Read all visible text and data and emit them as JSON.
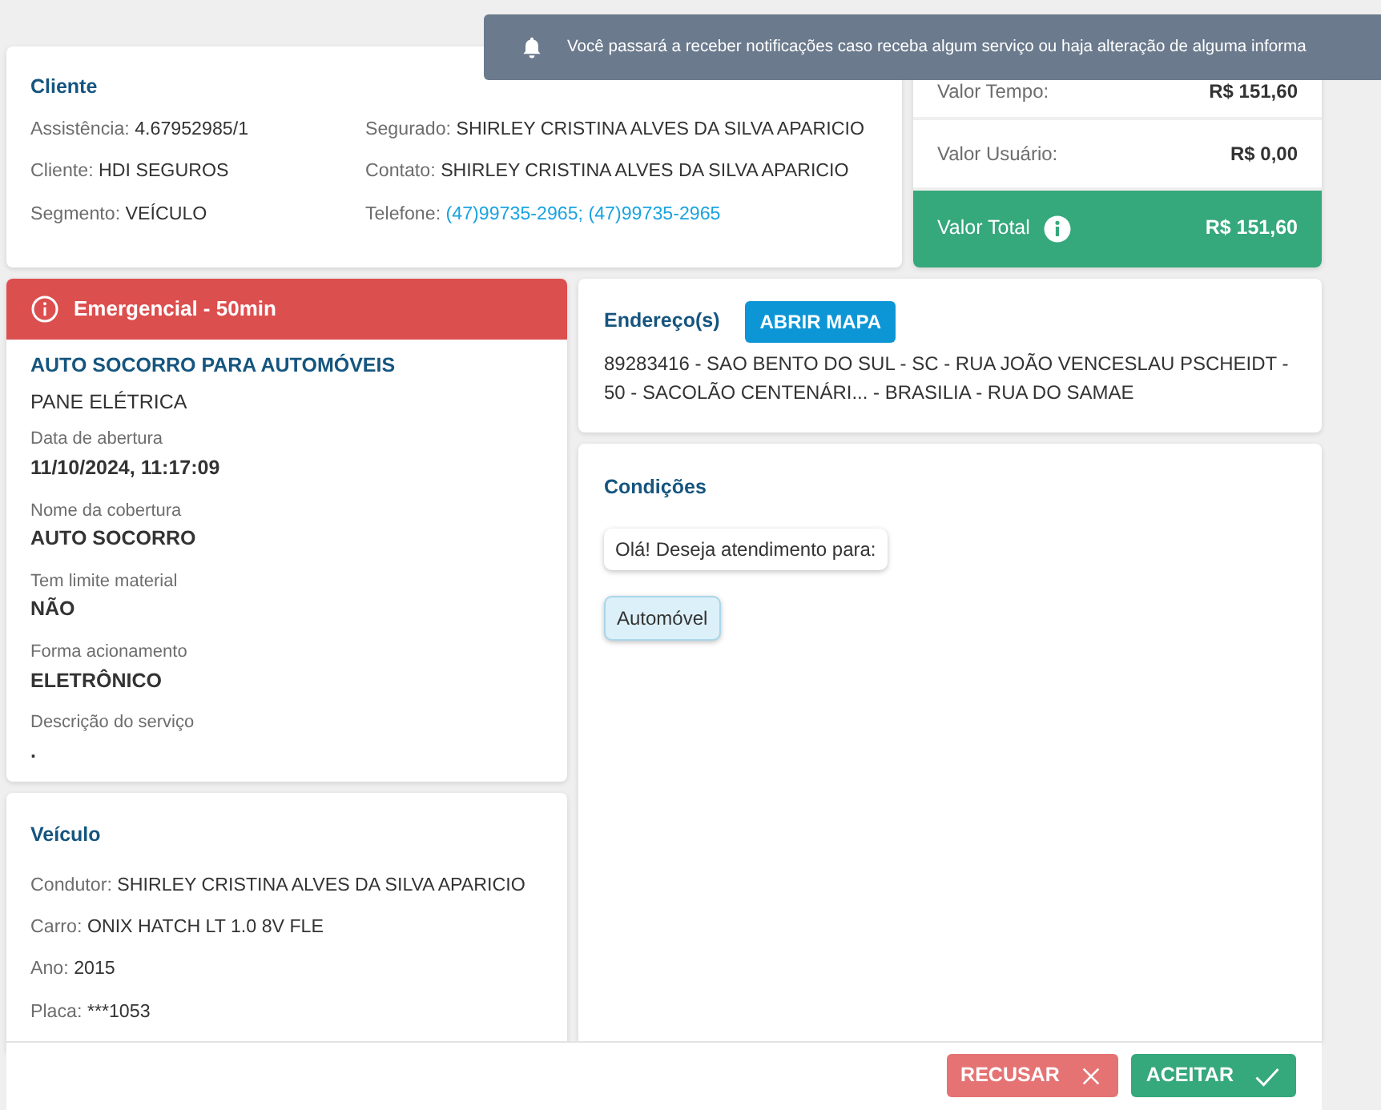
{
  "notification": {
    "text": "Você passará a receber notificações caso receba algum serviço ou haja alteração de alguma informa"
  },
  "client": {
    "title": "Cliente",
    "columns": [
      [
        {
          "label": "Assistência:",
          "value": "4.67952985/1",
          "kind": "text"
        },
        {
          "label": "Cliente:",
          "value": "HDI SEGUROS",
          "kind": "text"
        },
        {
          "label": "Segmento:",
          "value": "VEÍCULO",
          "kind": "text"
        }
      ],
      [
        {
          "label": "Segurado:",
          "value": "SHIRLEY CRISTINA ALVES DA SILVA APARICIO",
          "kind": "text"
        },
        {
          "label": "Contato:",
          "value": "SHIRLEY CRISTINA ALVES DA SILVA APARICIO",
          "kind": "text"
        },
        {
          "label": "Telefone:",
          "value": "(47)99735-2965; (47)99735-2965",
          "kind": "link"
        }
      ]
    ]
  },
  "values": {
    "rows": [
      {
        "label": "Valor Tempo:",
        "value": "R$ 151,60"
      },
      {
        "label": "Valor Usuário:",
        "value": "R$ 0,00"
      }
    ],
    "total": {
      "label": "Valor Total",
      "value": "R$ 151,60"
    }
  },
  "service": {
    "alert": "Emergencial - 50min",
    "title": "AUTO SOCORRO PARA AUTOMÓVEIS",
    "subtitle": "PANE ELÉTRICA",
    "fields": [
      {
        "label": "Data de abertura",
        "value": "11/10/2024, 11:17:09"
      },
      {
        "label": "Nome da cobertura",
        "value": "AUTO SOCORRO"
      },
      {
        "label": "Tem limite material",
        "value": "NÃO"
      },
      {
        "label": "Forma acionamento",
        "value": "ELETRÔNICO"
      },
      {
        "label": "Descrição do serviço",
        "value": "."
      }
    ]
  },
  "vehicle": {
    "title": "Veículo",
    "fields": [
      {
        "label": "Condutor:",
        "value": "SHIRLEY CRISTINA ALVES DA SILVA APARICIO"
      },
      {
        "label": "Carro:",
        "value": "ONIX HATCH LT 1.0 8V FLE"
      },
      {
        "label": "Ano:",
        "value": "2015"
      },
      {
        "label": "Placa:",
        "value": "***1053"
      }
    ]
  },
  "address": {
    "title": "Endereço(s)",
    "button": "ABRIR MAPA",
    "text": "89283416 - SAO BENTO DO SUL - SC - RUA JOÃO VENCESLAU PSCHEIDT - 50 - SACOLÃO CENTENÁRI... - BRASILIA - RUA DO SAMAE"
  },
  "conditions": {
    "title": "Condições",
    "messages": [
      {
        "kind": "bot",
        "text": "Olá! Deseja atendimento para:"
      },
      {
        "kind": "option",
        "text": "Automóvel"
      }
    ]
  },
  "actions": [
    {
      "kind": "reject",
      "label": "RECUSAR"
    },
    {
      "kind": "accept",
      "label": "ACEITAR"
    }
  ]
}
